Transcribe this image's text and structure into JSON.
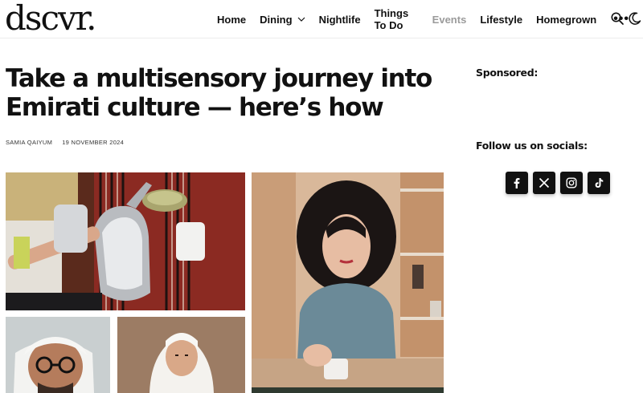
{
  "brand": {
    "logo": "dscvr."
  },
  "nav": {
    "items": [
      {
        "label": "Home"
      },
      {
        "label": "Dining"
      },
      {
        "label": "Nightlife"
      },
      {
        "label": "Things To Do"
      },
      {
        "label": "Events"
      },
      {
        "label": "Lifestyle"
      },
      {
        "label": "Homegrown"
      }
    ],
    "more_label": "•••"
  },
  "article": {
    "title_line1": "Take a multisensory journey into",
    "title_line2": "Emirati culture — here’s how",
    "author": "SAMIA QAIYUM",
    "date": "19 NOVEMBER 2024"
  },
  "sidebar": {
    "sponsored_label": "Sponsored:",
    "follow_label": "Follow us on socials:",
    "socials": [
      {
        "icon": "facebook-icon"
      },
      {
        "icon": "x-icon"
      },
      {
        "icon": "instagram-icon"
      },
      {
        "icon": "tiktok-icon"
      }
    ]
  },
  "colors": {
    "text": "#111111",
    "muted_nav": "#9b9b9b",
    "social_bg": "#111111",
    "divider": "#ececec"
  }
}
